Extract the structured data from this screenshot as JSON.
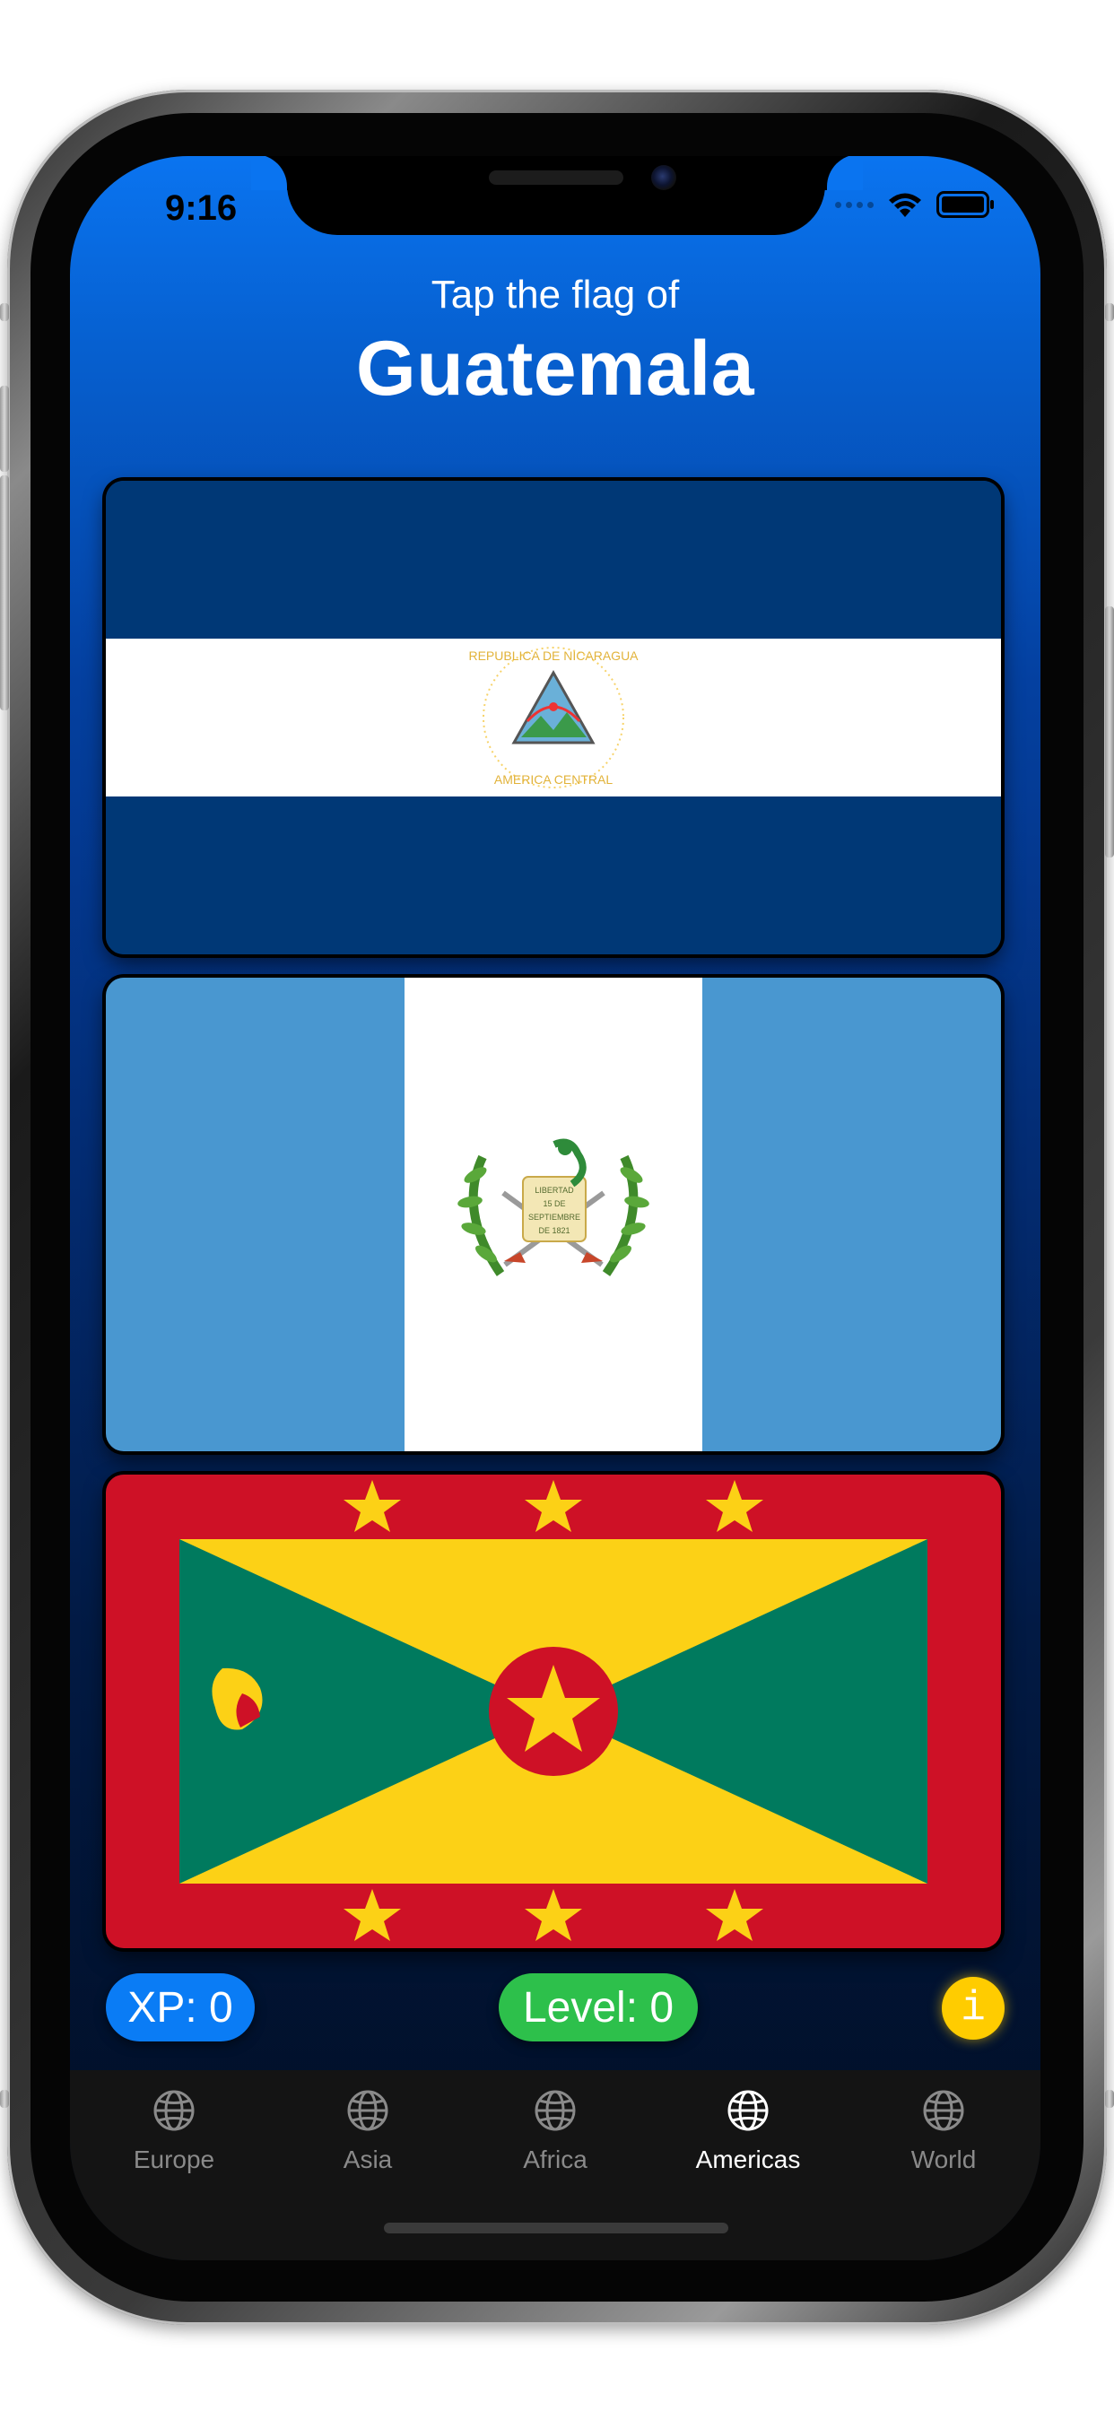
{
  "status_bar": {
    "time": "9:16"
  },
  "header": {
    "prompt": "Tap the flag of",
    "country": "Guatemala"
  },
  "flags": [
    {
      "name": "Nicaragua",
      "seal_top_text": "REPUBLICA DE NICARAGUA",
      "seal_bottom_text": "AMERICA CENTRAL"
    },
    {
      "name": "Guatemala",
      "scroll_text": [
        "LIBERTAD",
        "15 DE",
        "SEPTIEMBRE",
        "DE 1821"
      ]
    },
    {
      "name": "Grenada"
    }
  ],
  "stats": {
    "xp": "XP: 0",
    "level": "Level: 0",
    "info_label": "i"
  },
  "tabs": [
    {
      "label": "Europe",
      "icon": "globe-icon",
      "active": false
    },
    {
      "label": "Asia",
      "icon": "globe-icon",
      "active": false
    },
    {
      "label": "Africa",
      "icon": "globe-icon",
      "active": false
    },
    {
      "label": "Americas",
      "icon": "globe-icon",
      "active": true
    },
    {
      "label": "World",
      "icon": "globe-icon",
      "active": false
    }
  ],
  "colors": {
    "accent_blue": "#0a7cf5",
    "level_green": "#2dc04b",
    "info_yellow": "#ffcc00",
    "tabbar_bg": "#141414",
    "tab_inactive": "#8a8a8a",
    "tab_active": "#ffffff"
  }
}
